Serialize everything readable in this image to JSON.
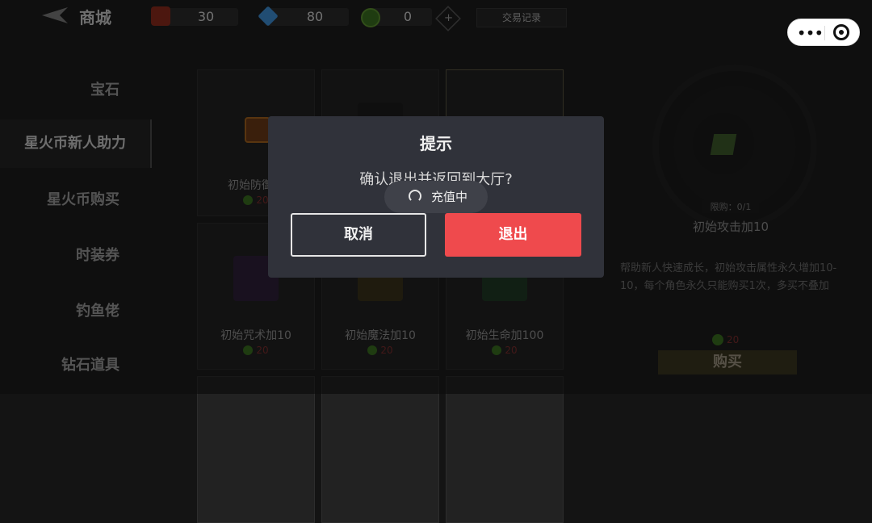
{
  "topbar": {
    "title": "商城",
    "resources": [
      {
        "icon": "red-box-icon",
        "value": "30"
      },
      {
        "icon": "blue-diamond-icon",
        "value": "80"
      },
      {
        "icon": "green-coin-icon",
        "value": "0"
      }
    ],
    "add_symbol": "+",
    "trade_record": "交易记录"
  },
  "sidebar": {
    "items": [
      {
        "label": "宝石"
      },
      {
        "label": "星火币新人助力",
        "active": true
      },
      {
        "label": "星火币购买"
      },
      {
        "label": "时装券"
      },
      {
        "label": "钓鱼佬"
      },
      {
        "label": "钻石道具"
      }
    ]
  },
  "grid": {
    "cards": [
      {
        "name": "初始防御加",
        "price": "20"
      },
      {
        "name": "",
        "price": ""
      },
      {
        "name": "",
        "price": ""
      },
      {
        "name": "初始咒术加10",
        "price": "20"
      },
      {
        "name": "初始魔法加10",
        "price": "20"
      },
      {
        "name": "初始生命加100",
        "price": "20"
      }
    ]
  },
  "detail": {
    "limit": "限购：0/1",
    "name": "初始攻击加10",
    "description": "帮助新人快速成长，初始攻击属性永久增加10-10，每个角色永久只能购买1次，多买不叠加",
    "price": "20",
    "buy_label": "购买"
  },
  "capsule": {
    "more": "•••"
  },
  "dialog": {
    "title": "提示",
    "message": "确认退出并返回到大厅?",
    "cancel_label": "取消",
    "confirm_label": "退出"
  },
  "toast": {
    "text": "充值中"
  },
  "colors": {
    "confirm": "#ef4a4d",
    "dialog_bg": "#30323a"
  }
}
